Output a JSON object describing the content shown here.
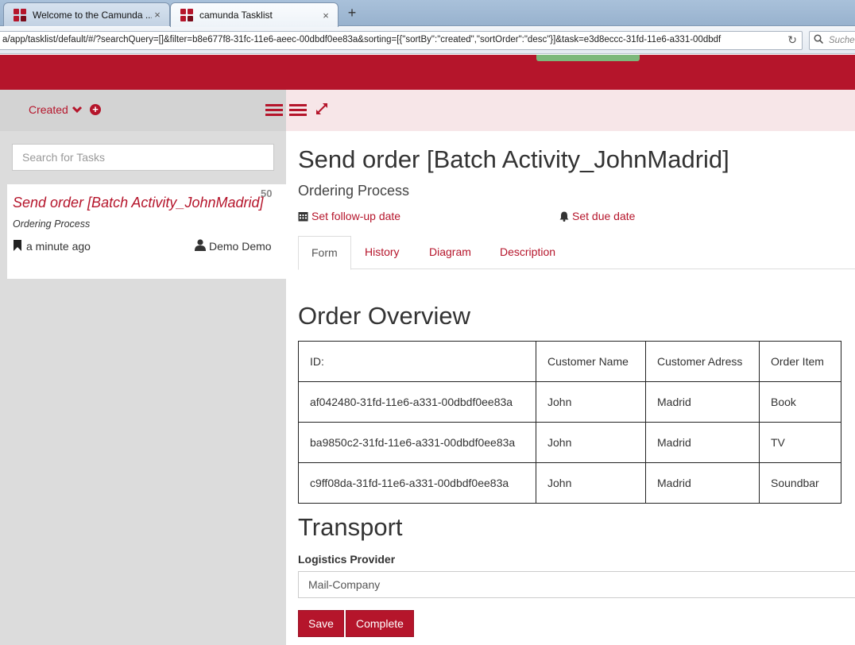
{
  "browser": {
    "tabs": [
      {
        "title": "Welcome to the Camunda ...",
        "close": "×"
      },
      {
        "title": "camunda Tasklist",
        "close": "×"
      }
    ],
    "new_tab": "+",
    "url": "a/app/tasklist/default/#/?searchQuery=[]&filter=b8e677f8-31fc-11e6-aeec-00dbdf0ee83a&sorting=[{\"sortBy\":\"created\",\"sortOrder\":\"desc\"}]&task=e3d8eccc-31fd-11e6-a331-00dbdf",
    "reload": "↻",
    "search_placeholder": "Suche"
  },
  "colors": {
    "brand": "#b5152b",
    "header_green": "#7cb87b"
  },
  "list": {
    "sort_label": "Created",
    "search_placeholder": "Search for Tasks",
    "tasks": [
      {
        "name": "Send order [Batch Activity_JohnMadrid]",
        "priority": "50",
        "process": "Ordering Process",
        "created": "a minute ago",
        "assignee": "Demo Demo"
      }
    ]
  },
  "task": {
    "title": "Send order [Batch Activity_JohnMadrid]",
    "process": "Ordering Process",
    "follow_up": "Set follow-up date",
    "due_date": "Set due date",
    "tabs": [
      "Form",
      "History",
      "Diagram",
      "Description"
    ],
    "active_tab": "Form"
  },
  "form": {
    "order_heading": "Order Overview",
    "columns": [
      "ID:",
      "Customer Name",
      "Customer Adress",
      "Order Item"
    ],
    "rows": [
      [
        "af042480-31fd-11e6-a331-00dbdf0ee83a",
        "John",
        "Madrid",
        "Book"
      ],
      [
        "ba9850c2-31fd-11e6-a331-00dbdf0ee83a",
        "John",
        "Madrid",
        "TV"
      ],
      [
        "c9ff08da-31fd-11e6-a331-00dbdf0ee83a",
        "John",
        "Madrid",
        "Soundbar"
      ]
    ],
    "transport_heading": "Transport",
    "logistics_label": "Logistics Provider",
    "logistics_value": "Mail-Company",
    "save": "Save",
    "complete": "Complete"
  }
}
